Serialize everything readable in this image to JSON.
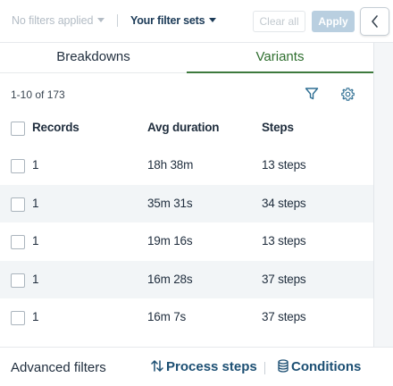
{
  "filterbar": {
    "no_filters_label": "No filters applied",
    "filter_sets_label": "Your filter sets",
    "clear_all_label": "Clear all",
    "apply_label": "Apply",
    "collapse_icon": "chevron-left-icon"
  },
  "tabs": [
    {
      "label": "Breakdowns",
      "active": false
    },
    {
      "label": "Variants",
      "active": true
    }
  ],
  "summary": {
    "range_text": "1-10 of 173",
    "filter_icon": "filter-icon",
    "settings_icon": "gear-icon"
  },
  "table": {
    "columns": [
      "Records",
      "Avg duration",
      "Steps"
    ],
    "rows": [
      {
        "records": "1",
        "avg_duration": "18h 38m",
        "steps": "13 steps"
      },
      {
        "records": "1",
        "avg_duration": "35m 31s",
        "steps": "34 steps"
      },
      {
        "records": "1",
        "avg_duration": "19m 16s",
        "steps": "13 steps"
      },
      {
        "records": "1",
        "avg_duration": "16m 28s",
        "steps": "37 steps"
      },
      {
        "records": "1",
        "avg_duration": "16m 7s",
        "steps": "37 steps"
      }
    ]
  },
  "footer": {
    "advanced_filters_label": "Advanced filters",
    "process_steps_label": "Process steps",
    "conditions_label": "Conditions"
  },
  "colors": {
    "accent_green": "#3d7a3d",
    "link_blue": "#1c4f73",
    "apply_disabled": "#b9cfe0",
    "row_alt": "#f2f5f7"
  }
}
